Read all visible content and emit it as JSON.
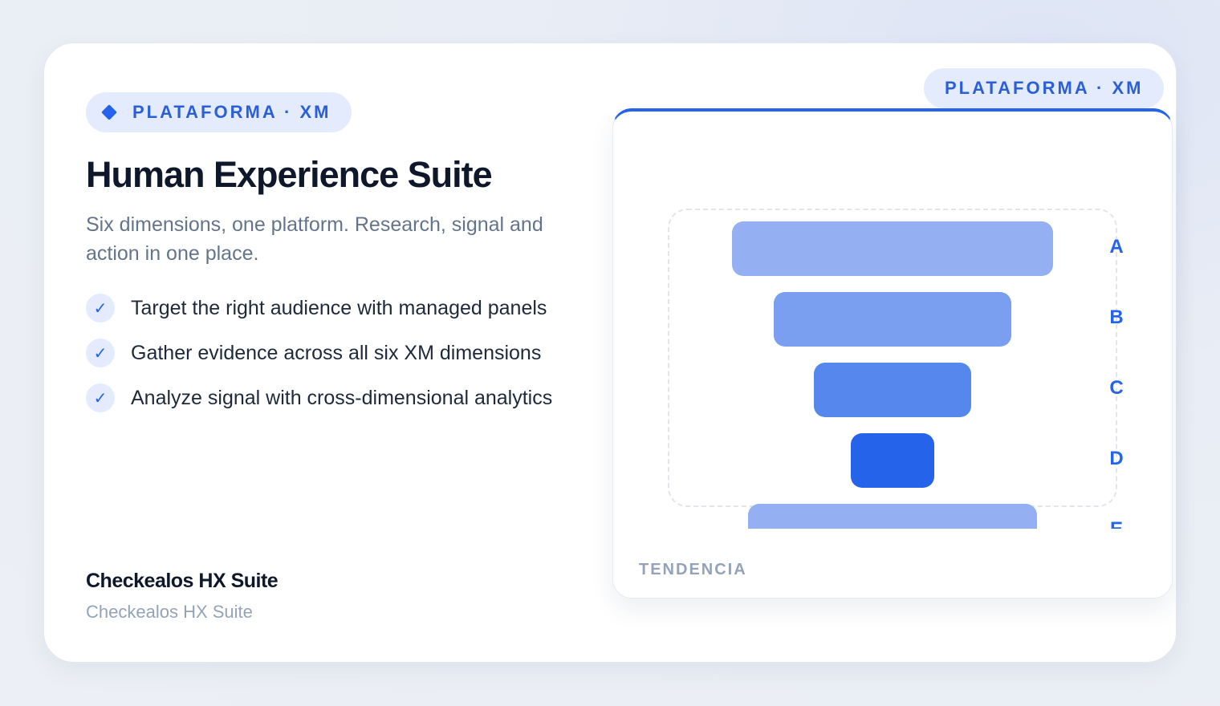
{
  "badge": {
    "label": "PLATAFORMA · XM",
    "icon": "diamond-icon"
  },
  "title": "Human Experience Suite",
  "subtitle": "Six dimensions, one platform. Research, signal and action in one place.",
  "features": [
    {
      "text": "Target the right audience with managed panels",
      "icon": "check-icon"
    },
    {
      "text": "Gather evidence across all six XM dimensions",
      "icon": "check-icon"
    },
    {
      "text": "Analyze signal with cross-dimensional analytics",
      "icon": "check-icon"
    }
  ],
  "brand": {
    "name": "Checkealos HX Suite",
    "sub": "Checkealos HX Suite"
  },
  "panel": {
    "badge": "PLATAFORMA · XM",
    "footer": "TENDENCIA"
  },
  "chart_data": {
    "type": "bar",
    "orientation": "funnel",
    "categories": [
      "A",
      "B",
      "C",
      "D",
      "E"
    ],
    "values": [
      100,
      74,
      49,
      26,
      90
    ],
    "colors": [
      "#94b0f3",
      "#7a9ef0",
      "#5587ec",
      "#2563eb",
      "#94b0f3"
    ]
  },
  "colors": {
    "accent": "#2563eb",
    "badge_bg": "#e3ebfc"
  }
}
